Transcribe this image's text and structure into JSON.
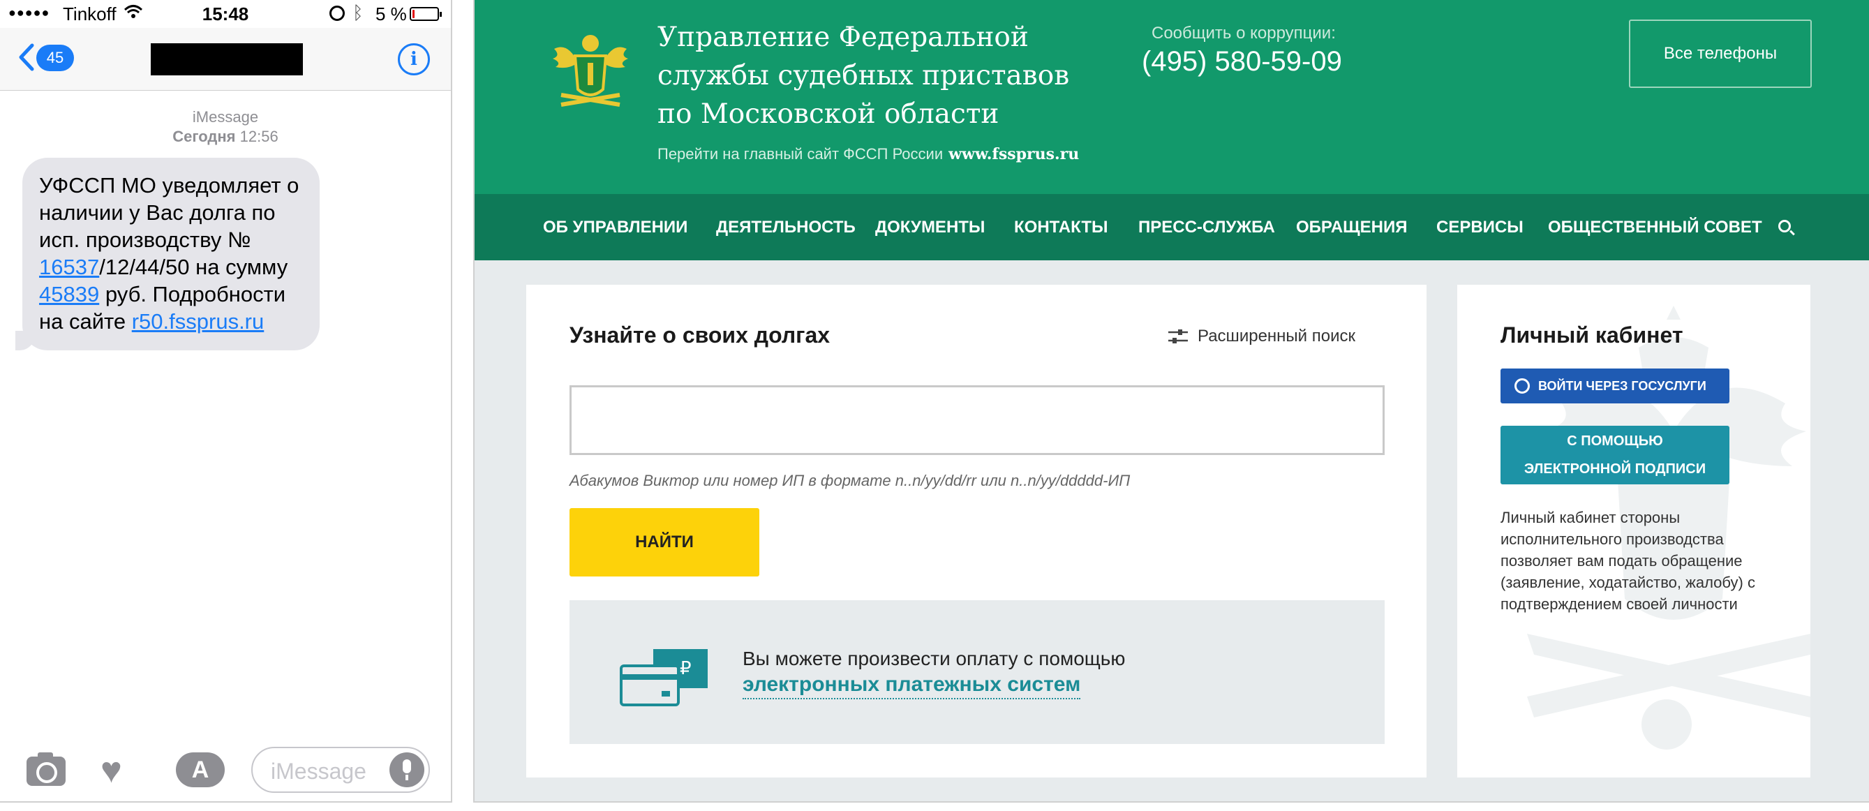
{
  "phone": {
    "status": {
      "signal": "●●●●●",
      "carrier": "Tinkoff",
      "time": "15:48",
      "battery_text": "5 %",
      "battery_level": 0.05,
      "battery_color": "#e01010"
    },
    "nav": {
      "back_count": "45",
      "contact_name": ""
    },
    "thread": {
      "service": "iMessage",
      "day": "Сегодня",
      "time": "12:56"
    },
    "message": {
      "part1": "УФССП МО уведомляет о наличии у Вас долга по исп. производству № ",
      "link1": "16537",
      "part2": "/12/44/50 на сумму ",
      "link2": "45839",
      "part3": " руб. Подробности на сайте ",
      "link3": "r50.fssprus.ru"
    },
    "composer": {
      "placeholder": "iMessage",
      "appstore_glyph": "A",
      "heart_glyph": "♥"
    },
    "colors": {
      "accent": "#1a7cf7",
      "bubble": "#e5e5ea"
    }
  },
  "site": {
    "colors": {
      "header": "#12996b",
      "menu": "#0e7a58",
      "find_button": "#fdd20a",
      "gosuslugi": "#1f5bb3",
      "esignature": "#1d93a6",
      "link": "#1b8c96"
    },
    "header": {
      "title_lines": [
        "Управление Федеральной",
        "службы судебных приставов",
        "по Московской области"
      ],
      "main_site_text": "Перейти на главный сайт ФССП России",
      "main_site_url": "www.fssprus.ru",
      "corruption_label": "Сообщить о коррупции:",
      "phone": "(495) 580-59-09",
      "all_phones": "Все телефоны"
    },
    "menu": [
      "ОБ УПРАВЛЕНИИ",
      "ДЕЯТЕЛЬНОСТЬ",
      "ДОКУМЕНТЫ",
      "КОНТАКТЫ",
      "ПРЕСС-СЛУЖБА",
      "ОБРАЩЕНИЯ",
      "СЕРВИСЫ",
      "ОБЩЕСТВЕННЫЙ СОВЕТ"
    ],
    "debts": {
      "title": "Узнайте о своих долгах",
      "advanced_search": "Расширенный поиск",
      "input_value": "",
      "hint": "Абакумов Виктор или номер ИП в формате n..n/yy/dd/rr или n..n/yy/ddddd-ИП",
      "find_button": "НАЙТИ",
      "pay_text": "Вы можете произвести оплату с помощью",
      "pay_link": "электронных платежных систем",
      "ruble_glyph": "₽"
    },
    "cabinet": {
      "title": "Личный кабинет",
      "gosuslugi_button": "ВОЙТИ ЧЕРЕЗ ГОСУСЛУГИ",
      "esig_line1": "С ПОМОЩЬЮ",
      "esig_line2": "ЭЛЕКТРОННОЙ ПОДПИСИ",
      "description": "Личный кабинет стороны исполнительного производства позволяет вам подать обращение (заявление, ходатайство, жалобу) с подтверждением своей личности"
    }
  }
}
